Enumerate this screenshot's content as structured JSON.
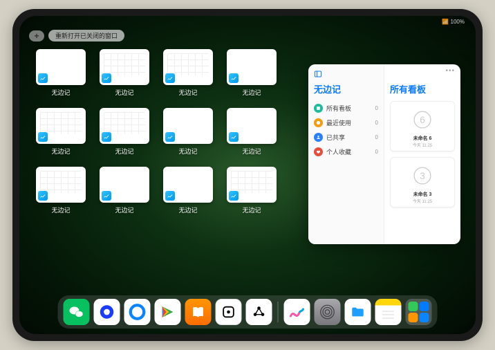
{
  "status": {
    "time": "",
    "indicators": "📶 100%"
  },
  "top_controls": {
    "plus": "+",
    "reopen": "重新打开已关闭的窗口"
  },
  "app_label": "无边记",
  "thumbnails": [
    {
      "style": "blank"
    },
    {
      "style": "grid"
    },
    {
      "style": "grid"
    },
    {
      "style": "blank"
    },
    {
      "style": "grid"
    },
    {
      "style": "grid"
    },
    {
      "style": "blank"
    },
    {
      "style": "blank"
    },
    {
      "style": "grid"
    },
    {
      "style": "blank"
    },
    {
      "style": "blank"
    },
    {
      "style": "grid"
    }
  ],
  "window": {
    "sidebar_title": "无边记",
    "items": [
      {
        "label": "所有看板",
        "count": "0",
        "color": "#1abc9c"
      },
      {
        "label": "最近使用",
        "count": "0",
        "color": "#f39c12"
      },
      {
        "label": "已共享",
        "count": "0",
        "color": "#2980ff"
      },
      {
        "label": "个人收藏",
        "count": "0",
        "color": "#e74c3c"
      }
    ],
    "main_title": "所有看板",
    "boards": [
      {
        "name": "未命名 6",
        "date": "今天 11:25",
        "digit": "6"
      },
      {
        "name": "未命名 3",
        "date": "今天 11:25",
        "digit": "3"
      }
    ]
  },
  "dock": [
    {
      "name": "wechat"
    },
    {
      "name": "browser-o"
    },
    {
      "name": "quark"
    },
    {
      "name": "play"
    },
    {
      "name": "books"
    },
    {
      "name": "dice"
    },
    {
      "name": "molecule"
    },
    {
      "name": "freeform"
    },
    {
      "name": "settings"
    },
    {
      "name": "files"
    },
    {
      "name": "notes"
    },
    {
      "name": "app-library"
    }
  ]
}
